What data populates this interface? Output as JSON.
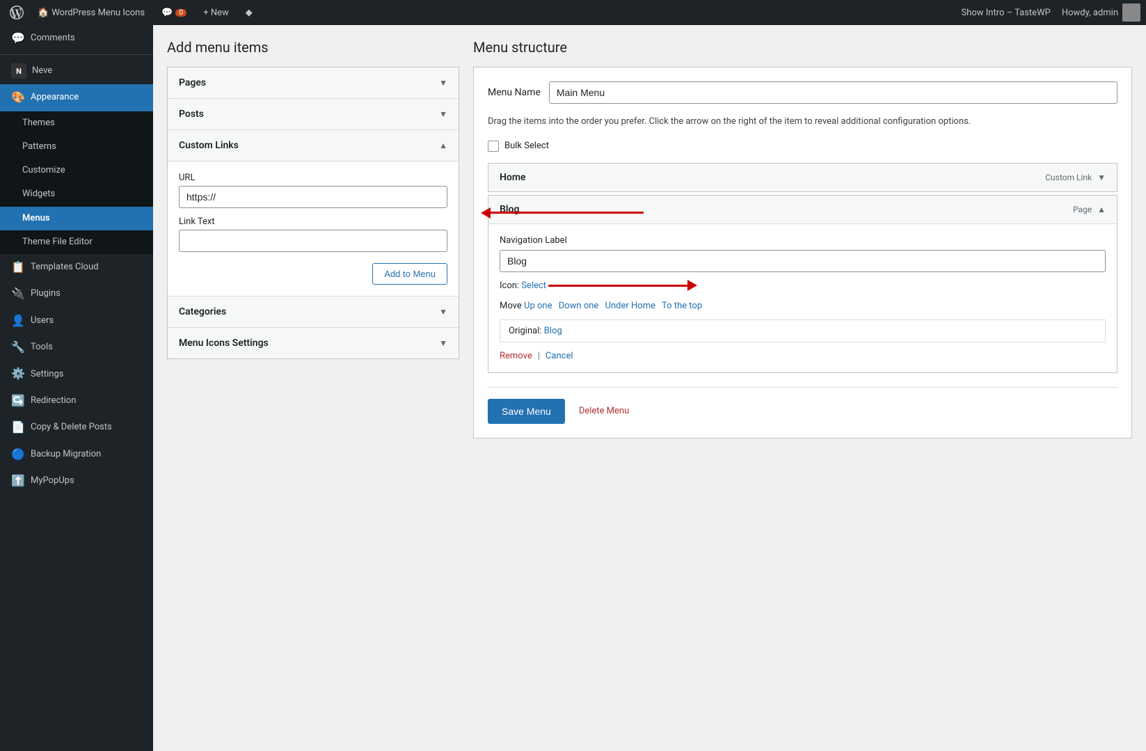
{
  "admin_bar": {
    "wp_logo": "WP",
    "site_name": "WordPress Menu Icons",
    "comment_icon": "💬",
    "comment_count": "0",
    "new_label": "+ New",
    "diamond_icon": "◆",
    "show_intro": "Show Intro – TasteWP",
    "howdy": "Howdy, admin"
  },
  "sidebar": {
    "comments_label": "Comments",
    "neve_label": "Neve",
    "appearance_label": "Appearance",
    "sub_items": [
      {
        "label": "Themes"
      },
      {
        "label": "Patterns"
      },
      {
        "label": "Customize"
      },
      {
        "label": "Widgets"
      },
      {
        "label": "Menus",
        "active": true
      },
      {
        "label": "Theme File Editor"
      }
    ],
    "templates_cloud_label": "Templates Cloud",
    "plugins_label": "Plugins",
    "users_label": "Users",
    "tools_label": "Tools",
    "settings_label": "Settings",
    "redirection_label": "Redirection",
    "copy_delete_label": "Copy & Delete Posts",
    "backup_migration_label": "Backup Migration",
    "mypopups_label": "MyPopUps"
  },
  "add_menu": {
    "section_title": "Add menu items",
    "pages_label": "Pages",
    "posts_label": "Posts",
    "custom_links_label": "Custom Links",
    "url_label": "URL",
    "url_value": "https://",
    "link_text_label": "Link Text",
    "add_to_menu_label": "Add to Menu",
    "categories_label": "Categories",
    "menu_icons_settings_label": "Menu Icons Settings"
  },
  "menu_structure": {
    "section_title": "Menu structure",
    "menu_name_label": "Menu Name",
    "menu_name_value": "Main Menu",
    "instruction": "Drag the items into the order you prefer. Click the arrow on the right of the item to reveal additional configuration options.",
    "bulk_select_label": "Bulk Select",
    "home_item": {
      "title": "Home",
      "type": "Custom Link",
      "chevron": "▼"
    },
    "blog_item": {
      "title": "Blog",
      "type": "Page",
      "chevron": "▲",
      "nav_label_title": "Navigation Label",
      "nav_label_value": "Blog",
      "icon_label": "Icon:",
      "icon_select": "Select",
      "move_label": "Move",
      "move_up": "Up one",
      "move_down": "Down one",
      "move_under": "Under Home",
      "move_top": "To the top",
      "original_label": "Original:",
      "original_value": "Blog",
      "remove_label": "Remove",
      "cancel_label": "Cancel"
    },
    "save_menu_label": "Save Menu",
    "delete_menu_label": "Delete Menu"
  }
}
